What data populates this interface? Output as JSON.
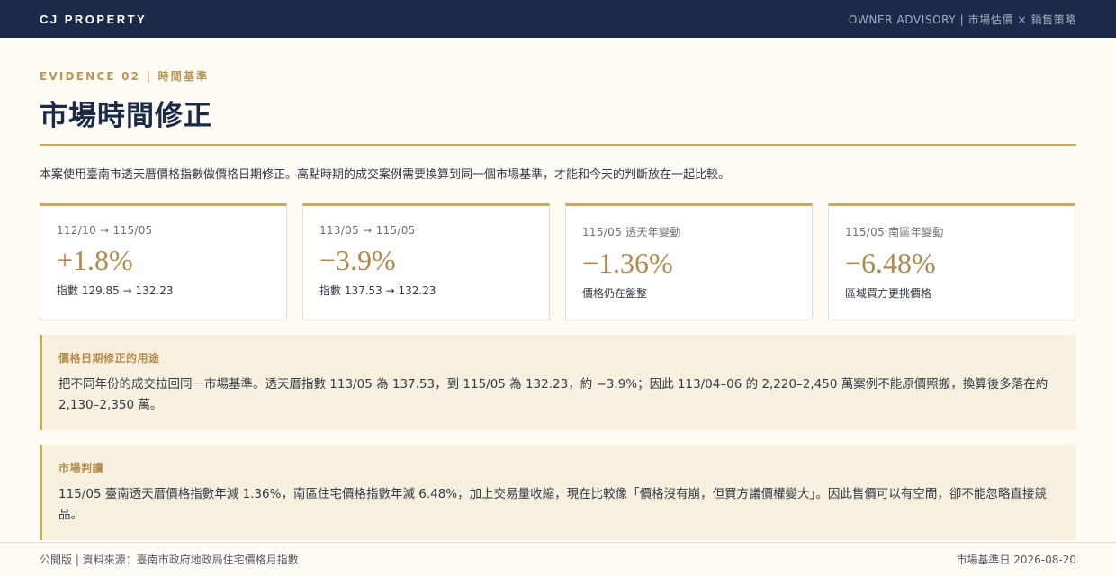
{
  "header": {
    "brand": "CJ PROPERTY",
    "nav": "OWNER ADVISORY | 市場估價 × 銷售策略"
  },
  "section": {
    "eyebrow": "EVIDENCE 02 | 時間基準",
    "title": "市場時間修正",
    "intro": "本案使用臺南市透天厝價格指數做價格日期修正。高點時期的成交案例需要換算到同一個市場基準，才能和今天的判斷放在一起比較。"
  },
  "cards": [
    {
      "label": "112/10 → 115/05",
      "value": "+1.8%",
      "note": "指數 129.85 → 132.23"
    },
    {
      "label": "113/05 → 115/05",
      "value": "−3.9%",
      "note": "指數 137.53 → 132.23"
    },
    {
      "label": "115/05 透天年變動",
      "value": "−1.36%",
      "note": "價格仍在盤整"
    },
    {
      "label": "115/05 南區年變動",
      "value": "−6.48%",
      "note": "區域買方更挑價格"
    }
  ],
  "notes": [
    {
      "title": "價格日期修正的用途",
      "body": "把不同年份的成交拉回同一市場基準。透天厝指數 113/05 為 137.53，到 115/05 為 132.23，約 −3.9%；因此 113/04–06 的 2,220–2,450 萬案例不能原價照搬，換算後多落在約 2,130–2,350 萬。"
    },
    {
      "title": "市場判讀",
      "body": "115/05 臺南透天厝價格指數年減 1.36%，南區住宅價格指數年減 6.48%，加上交易量收縮，現在比較像「價格沒有崩，但買方議價權變大」。因此售價可以有空間，卻不能忽略直接競品。"
    }
  ],
  "footer": {
    "left": "公開版 | 資料來源：臺南市政府地政局住宅價格月指數",
    "right": "市場基準日 2026-08-20"
  },
  "colors": {
    "navy": "#1c2a4a",
    "gold": "#c9a864",
    "gold_text": "#b08a4e",
    "cream": "#fdfbf3",
    "note_bg": "#f7f0df"
  }
}
